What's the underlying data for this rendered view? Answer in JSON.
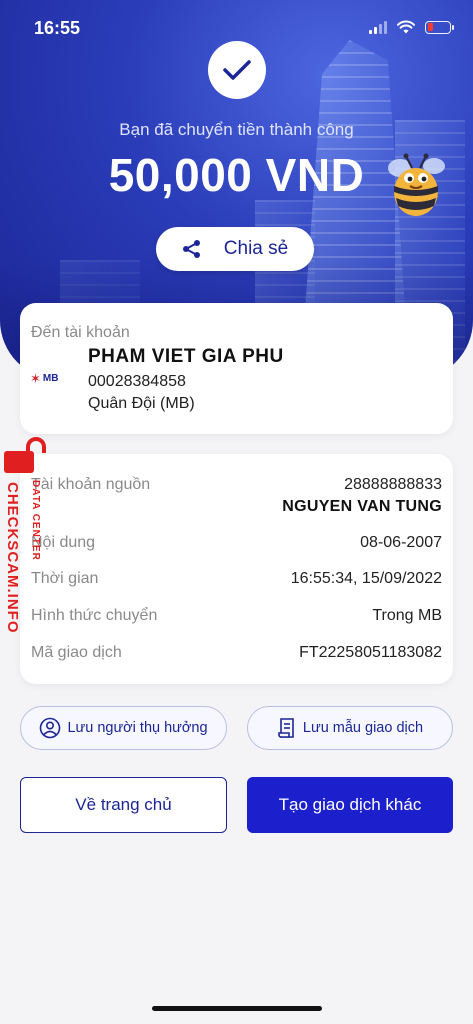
{
  "status_bar": {
    "time": "16:55"
  },
  "hero": {
    "subtitle": "Bạn đã chuyển tiền thành công",
    "amount": "50,000 VND",
    "share_label": "Chia sẻ"
  },
  "recipient": {
    "title": "Đến tài khoản",
    "bank_logo_text": "MB",
    "name": "PHAM VIET GIA PHU",
    "account": "00028384858",
    "bank": "Quân Đội (MB)"
  },
  "details": {
    "source_label": "Tài khoản nguồn",
    "source_account": "28888888833",
    "source_name": "NGUYEN VAN TUNG",
    "content_label": "Nội dung",
    "content_value": "08-06-2007",
    "time_label": "Thời gian",
    "time_value": "16:55:34, 15/09/2022",
    "method_label": "Hình thức chuyển",
    "method_value": "Trong MB",
    "code_label": "Mã giao dịch",
    "code_value": "FT22258051183082"
  },
  "watermark": {
    "main": "CHECKSCAM.INFO",
    "sub": "DATA CENTER"
  },
  "actions": {
    "save_beneficiary": "Lưu người thụ hưởng",
    "save_template": "Lưu mẫu giao dịch",
    "home": "Về trang chủ",
    "new_transaction": "Tạo giao dịch khác"
  },
  "colors": {
    "brand_blue": "#1c2696",
    "primary_button": "#1c1fcc",
    "watermark_red": "#e02020"
  }
}
